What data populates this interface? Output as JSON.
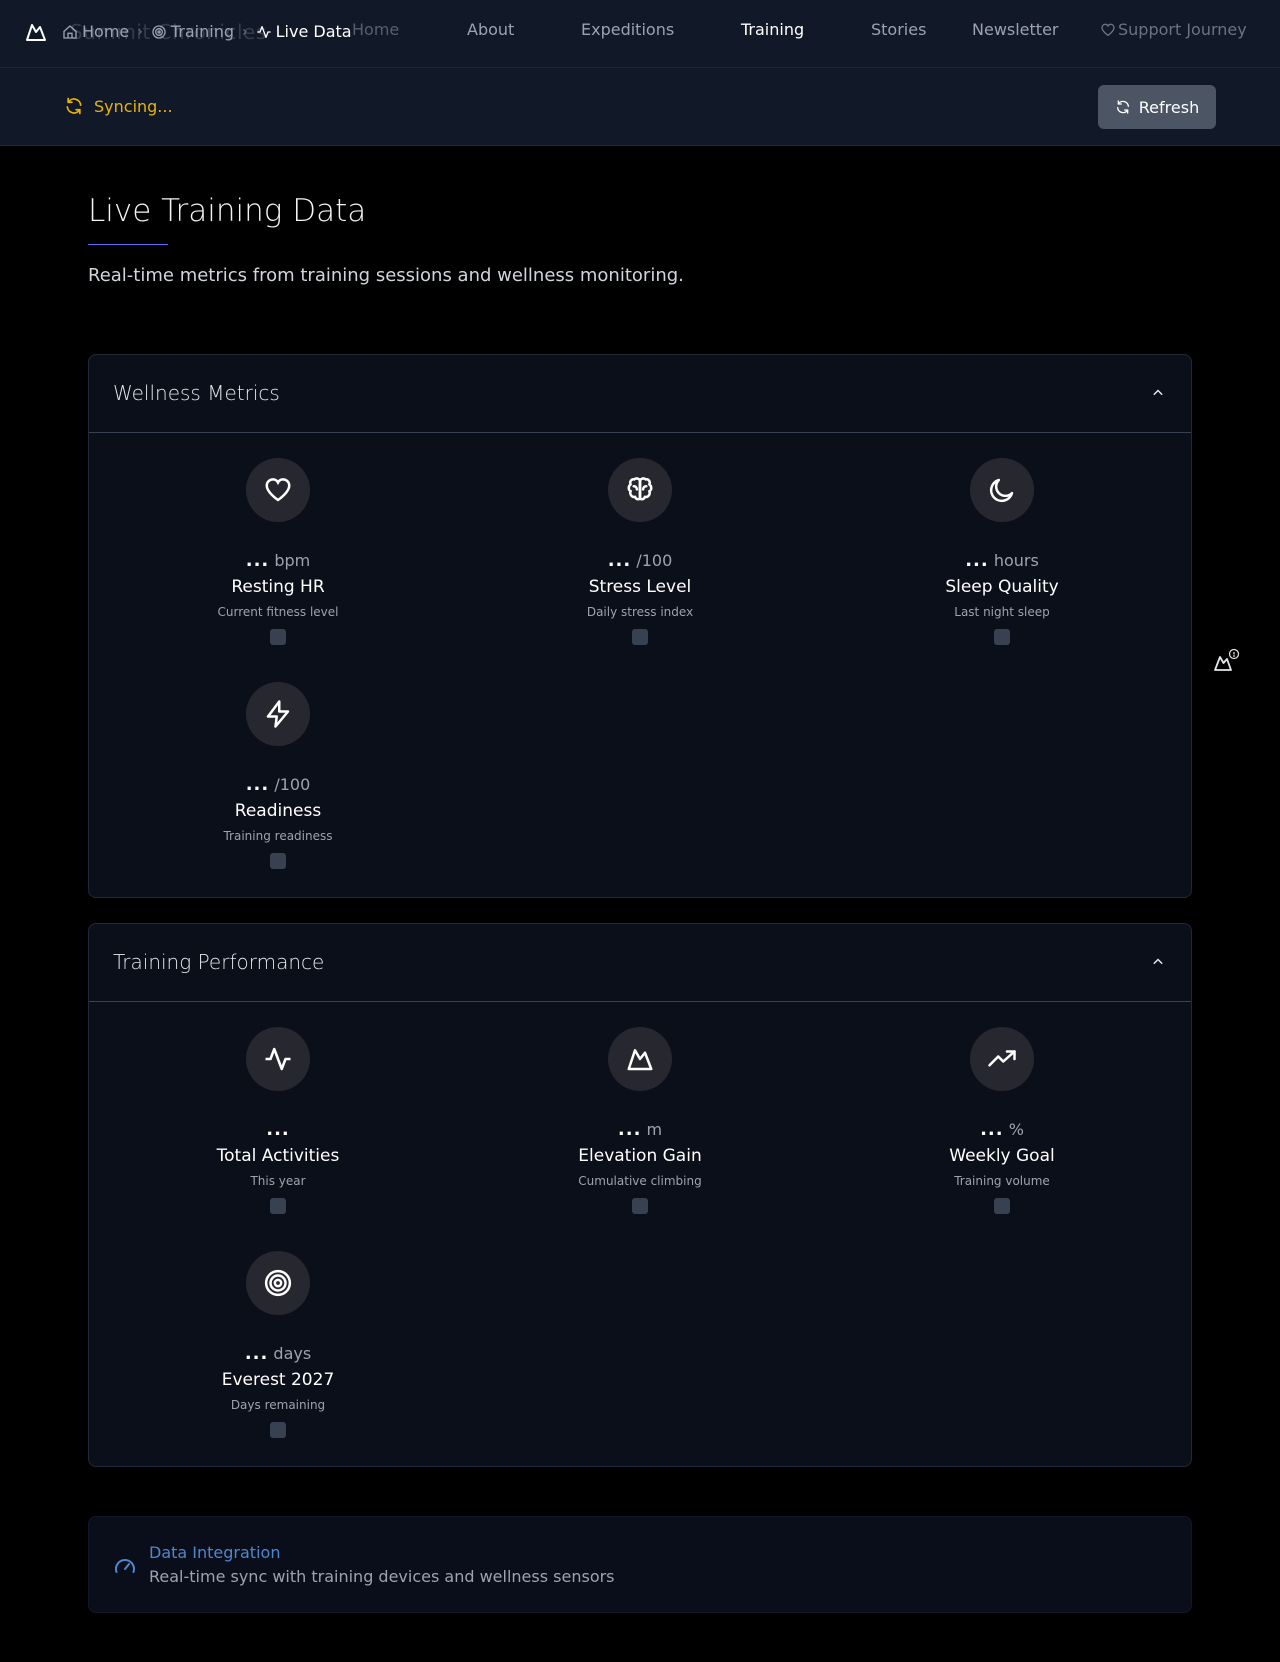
{
  "nav": {
    "brand": "Summit Chronicles",
    "breadcrumb": [
      {
        "label": "Home",
        "icon": "home-icon"
      },
      {
        "label": "Training",
        "icon": "target-icon"
      },
      {
        "label": "Live Data",
        "icon": "activity-icon"
      }
    ],
    "menu": [
      {
        "label": "Home",
        "active": false
      },
      {
        "label": "About",
        "active": false
      },
      {
        "label": "Expeditions",
        "active": false
      },
      {
        "label": "Training",
        "active": true
      },
      {
        "label": "Stories",
        "active": false
      },
      {
        "label": "Newsletter",
        "active": false
      }
    ],
    "support_label": "Support Journey"
  },
  "sync": {
    "status": "Syncing...",
    "refresh_label": "Refresh",
    "status_color": "#eab308"
  },
  "header": {
    "title": "Live Training Data",
    "subtitle": "Real-time metrics from training sessions and wellness monitoring."
  },
  "wellness": {
    "title": "Wellness Metrics",
    "metrics": [
      {
        "value": "...",
        "unit": "bpm",
        "label": "Resting HR",
        "desc": "Current fitness level",
        "icon": "heart-icon"
      },
      {
        "value": "...",
        "unit": "/100",
        "label": "Stress Level",
        "desc": "Daily stress index",
        "icon": "brain-icon"
      },
      {
        "value": "...",
        "unit": "hours",
        "label": "Sleep Quality",
        "desc": "Last night sleep",
        "icon": "moon-icon"
      },
      {
        "value": "...",
        "unit": "/100",
        "label": "Readiness",
        "desc": "Training readiness",
        "icon": "zap-icon"
      }
    ]
  },
  "performance": {
    "title": "Training Performance",
    "metrics": [
      {
        "value": "...",
        "unit": "",
        "label": "Total Activities",
        "desc": "This year",
        "icon": "activity-icon"
      },
      {
        "value": "...",
        "unit": "m",
        "label": "Elevation Gain",
        "desc": "Cumulative climbing",
        "icon": "mountain-icon"
      },
      {
        "value": "...",
        "unit": "%",
        "label": "Weekly Goal",
        "desc": "Training volume",
        "icon": "trending-up-icon"
      },
      {
        "value": "...",
        "unit": "days",
        "label": "Everest 2027",
        "desc": "Days remaining",
        "icon": "target-icon"
      }
    ]
  },
  "integration": {
    "title": "Data Integration",
    "desc": "Real-time sync with training devices and wellness sensors"
  },
  "colors": {
    "accent": "#6366f1",
    "background": "#000000",
    "panel": "#0b0f19",
    "link": "#60a5fa"
  }
}
